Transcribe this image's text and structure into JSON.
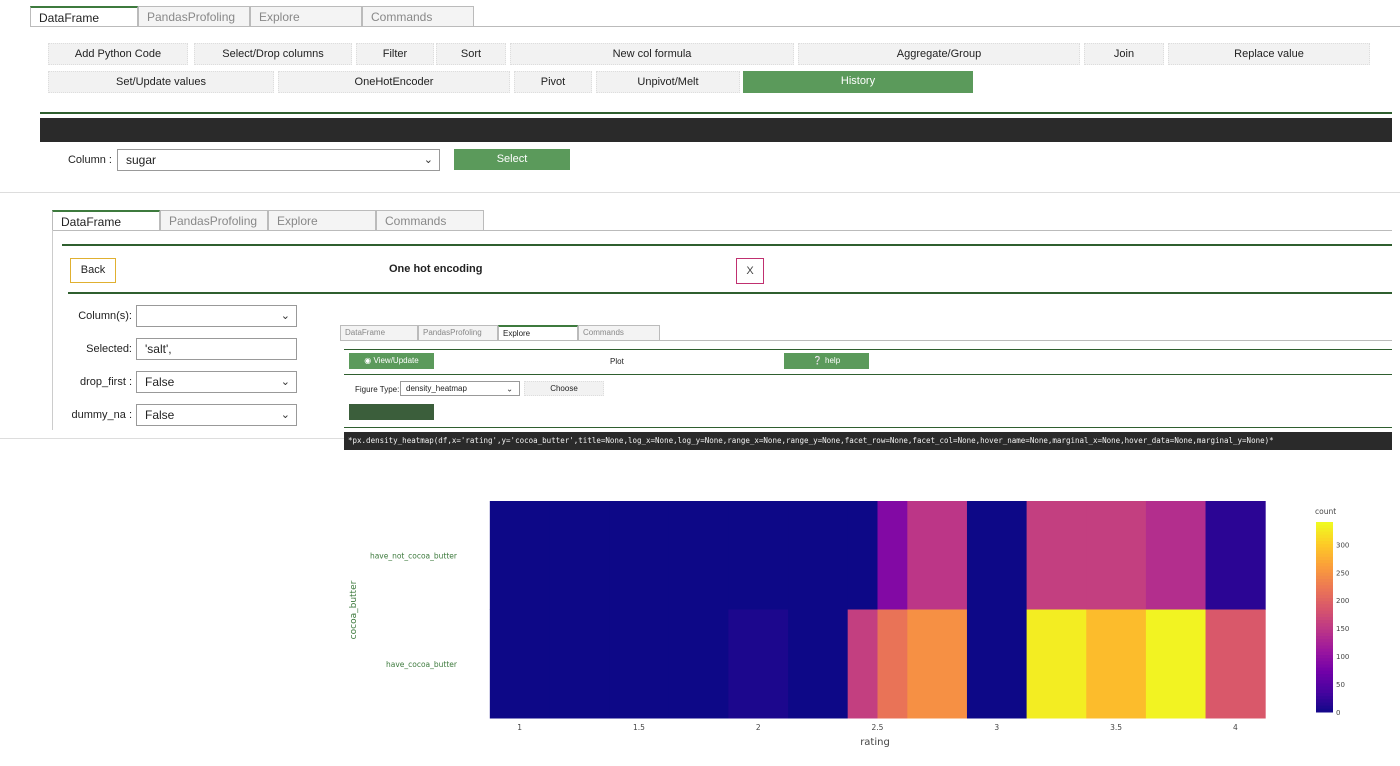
{
  "top_panel": {
    "tabs": [
      {
        "label": "DataFrame",
        "active": true
      },
      {
        "label": "PandasProfoling",
        "active": false
      },
      {
        "label": "Explore",
        "active": false
      },
      {
        "label": "Commands",
        "active": false
      }
    ],
    "commands_row1": [
      "Add Python Code",
      "Select/Drop columns",
      "Filter",
      "Sort",
      "New col formula",
      "Aggregate/Group",
      "Join",
      "Replace value"
    ],
    "commands_row2": [
      "Set/Update values",
      "OneHotEncoder",
      "Pivot",
      "Unpivot/Melt",
      "History"
    ],
    "column_label": "Column :",
    "column_value": "sugar",
    "select_label": "Select"
  },
  "middle_panel": {
    "tabs": [
      {
        "label": "DataFrame",
        "active": true
      },
      {
        "label": "PandasProfoling",
        "active": false
      },
      {
        "label": "Explore",
        "active": false
      },
      {
        "label": "Commands",
        "active": false
      }
    ],
    "back_label": "Back",
    "title": "One hot encoding",
    "close_label": "X",
    "fields": [
      {
        "label": "Column(s):",
        "value": "",
        "type": "select"
      },
      {
        "label": "Selected:",
        "value": "'salt',",
        "type": "input"
      },
      {
        "label": "drop_first :",
        "value": "False",
        "type": "select"
      },
      {
        "label": "dummy_na :",
        "value": "False",
        "type": "select"
      }
    ]
  },
  "explore_panel": {
    "tabs": [
      {
        "label": "DataFrame",
        "active": false
      },
      {
        "label": "PandasProfoling",
        "active": false
      },
      {
        "label": "Explore",
        "active": true
      },
      {
        "label": "Commands",
        "active": false
      }
    ],
    "view_update_label": "View/Update",
    "plot_label": "Plot",
    "help_label": "help",
    "figure_type_label": "Figure Type:",
    "figure_type_value": "density_heatmap",
    "choose_label": "Choose",
    "code": "*px.density_heatmap(df,x='rating',y='cocoa_butter',title=None,log_x=None,log_y=None,range_x=None,range_y=None,facet_row=None,facet_col=None,hover_name=None,marginal_x=None,hover_data=None,marginal_y=None)*"
  },
  "chart_data": {
    "type": "heatmap",
    "title": "",
    "xlabel": "rating",
    "ylabel": "cocoa_butter",
    "x_bins": [
      0.875,
      1.125,
      1.375,
      1.625,
      1.875,
      2.125,
      2.375,
      2.5,
      2.625,
      2.875,
      3.125,
      3.375,
      3.625,
      3.875,
      4.125
    ],
    "x_ticks": [
      "1",
      "1.5",
      "2",
      "2.5",
      "3",
      "3.5",
      "4"
    ],
    "x_tick_values": [
      1,
      1.5,
      2,
      2.5,
      3,
      3.5,
      4
    ],
    "x_range": [
      0.75,
      4.25
    ],
    "y_categories": [
      "have_not_cocoa_butter",
      "have_cocoa_butter"
    ],
    "z": [
      [
        0,
        0,
        0,
        0,
        0,
        0,
        0,
        90,
        150,
        0,
        160,
        160,
        140,
        20
      ],
      [
        0,
        0,
        0,
        0,
        10,
        0,
        160,
        220,
        250,
        0,
        330,
        290,
        335,
        190
      ]
    ],
    "colorbar_title": "count",
    "colorbar_ticks": [
      0,
      50,
      100,
      150,
      200,
      250,
      300
    ],
    "zmax": 340,
    "colorscale": [
      "#0d0887",
      "#46039f",
      "#7201a8",
      "#9c179e",
      "#bd3786",
      "#d8576b",
      "#ed7953",
      "#fb9f3a",
      "#fdca26",
      "#f0f921"
    ]
  },
  "colors": {
    "green": "#5b9a5b",
    "dark_band": "#2a2a2a",
    "accent_border": "#2f5f2f"
  }
}
